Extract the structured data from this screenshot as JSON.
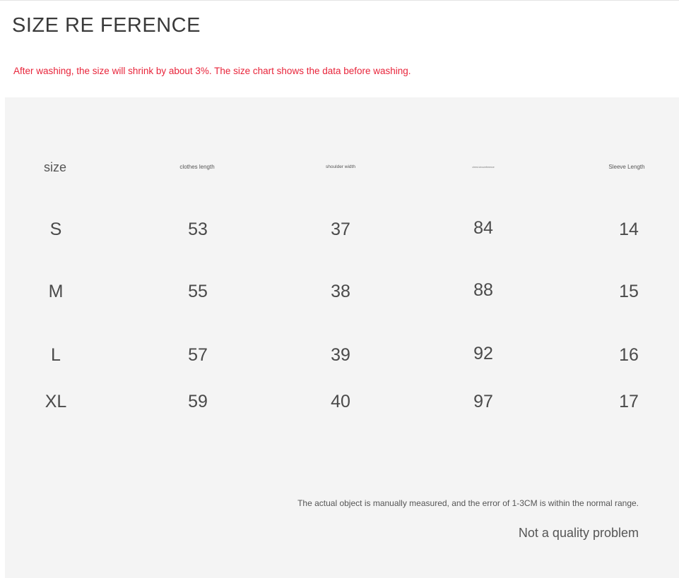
{
  "title": "SIZE RE FERENCE",
  "notice": "After washing, the size will shrink by about 3%. The size chart shows the data before washing.",
  "table": {
    "headers": [
      "size",
      "clothes length",
      "shoulder width",
      "chest circumference",
      "Sleeve Length"
    ],
    "rows": [
      [
        "S",
        "53",
        "37",
        "84",
        "14"
      ],
      [
        "M",
        "55",
        "38",
        "88",
        "15"
      ],
      [
        "L",
        "57",
        "39",
        "92",
        "16"
      ],
      [
        "XL",
        "59",
        "40",
        "97",
        "17"
      ]
    ]
  },
  "footnote": "The actual object is manually measured, and the error of 1-3CM is within the normal range.",
  "quality_note": "Not a quality problem",
  "colors": {
    "notice_text": "#e8243a",
    "panel_background": "#f4f4f4"
  }
}
